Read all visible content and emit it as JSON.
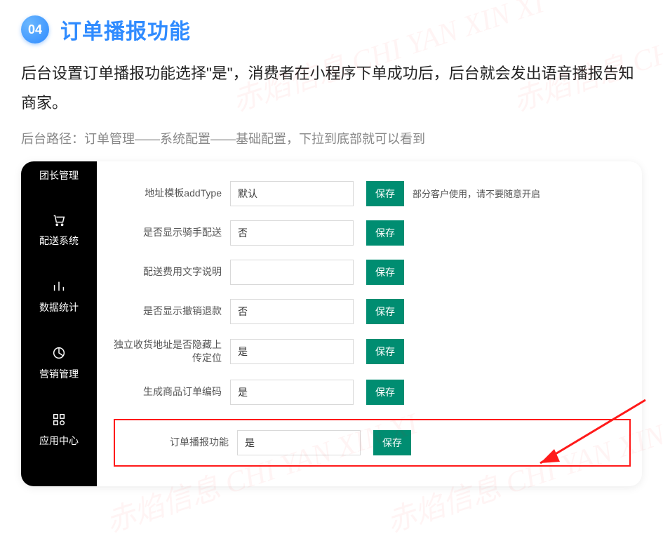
{
  "badge": "04",
  "title": "订单播报功能",
  "description": "后台设置订单播报功能选择\"是\"，消费者在小程序下单成功后，后台就会发出语音播报告知商家。",
  "path_line": "后台路径：订单管理——系统配置——基础配置，下拉到底部就可以看到",
  "sidebar": {
    "top": "团长管理",
    "items": [
      {
        "label": "配送系统"
      },
      {
        "label": "数据统计"
      },
      {
        "label": "营销管理"
      },
      {
        "label": "应用中心"
      }
    ]
  },
  "rows": [
    {
      "label": "地址模板addType",
      "value": "默认",
      "btn": "保存",
      "note": "部分客户使用，请不要随意开启"
    },
    {
      "label": "是否显示骑手配送",
      "value": "否",
      "btn": "保存",
      "note": ""
    },
    {
      "label": "配送费用文字说明",
      "value": "",
      "btn": "保存",
      "note": ""
    },
    {
      "label": "是否显示撤销退款",
      "value": "否",
      "btn": "保存",
      "note": ""
    },
    {
      "label": "独立收货地址是否隐藏上传定位",
      "value": "是",
      "btn": "保存",
      "note": ""
    },
    {
      "label": "生成商品订单编码",
      "value": "是",
      "btn": "保存",
      "note": ""
    }
  ],
  "highlight_row": {
    "label": "订单播报功能",
    "value": "是",
    "btn": "保存"
  },
  "watermark": "赤焰信息 CHI YAN XIN XI"
}
